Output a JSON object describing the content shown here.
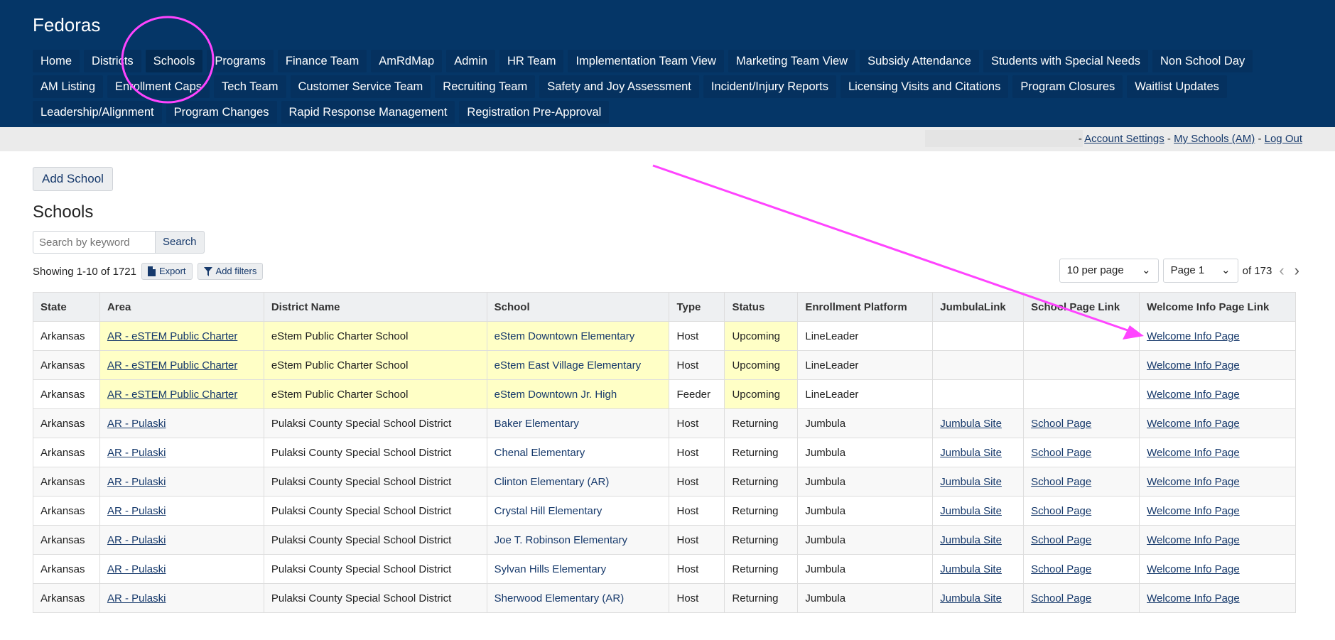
{
  "app": {
    "title": "Fedoras"
  },
  "nav": [
    "Home",
    "Districts",
    "Schools",
    "Programs",
    "Finance Team",
    "AmRdMap",
    "Admin",
    "HR Team",
    "Implementation Team View",
    "Marketing Team View",
    "Subsidy Attendance",
    "Students with Special Needs",
    "Non School Day",
    "AM Listing",
    "Enrollment Caps",
    "Tech Team",
    "Customer Service Team",
    "Recruiting Team",
    "Safety and Joy Assessment",
    "Incident/Injury Reports",
    "Licensing Visits and Citations",
    "Program Closures",
    "Waitlist Updates",
    "Leadership/Alignment",
    "Program Changes",
    "Rapid Response Management",
    "Registration Pre-Approval"
  ],
  "nav_active": "Schools",
  "userbar": {
    "sep": "-",
    "account_settings": "Account Settings",
    "my_schools": "My Schools (AM)",
    "log_out": "Log Out"
  },
  "main": {
    "add_button": "Add School",
    "title": "Schools",
    "search_placeholder": "Search by keyword",
    "search_button": "Search",
    "showing": "Showing 1-10 of 1721",
    "export": "Export",
    "add_filters": "Add filters",
    "per_page": "10 per page",
    "page": "Page 1",
    "of_pages": "of 173"
  },
  "colors": {
    "header": "#053667",
    "highlight": "#ffffc6",
    "annotation": "#ff44ff",
    "link": "#16396b"
  },
  "table": {
    "columns": [
      "State",
      "Area",
      "District Name",
      "School",
      "Type",
      "Status",
      "Enrollment Platform",
      "JumbulaLink",
      "School Page Link",
      "Welcome Info Page Link"
    ],
    "rows": [
      {
        "state": "Arkansas",
        "area": "AR - eSTEM Public Charter",
        "district": "eStem Public Charter School",
        "school": "eStem Downtown Elementary",
        "type": "Host",
        "status": "Upcoming",
        "platform": "LineLeader",
        "jumbula": "",
        "school_page": "",
        "welcome": "Welcome Info Page",
        "highlight": true
      },
      {
        "state": "Arkansas",
        "area": "AR - eSTEM Public Charter",
        "district": "eStem Public Charter School",
        "school": "eStem East Village Elementary",
        "type": "Host",
        "status": "Upcoming",
        "platform": "LineLeader",
        "jumbula": "",
        "school_page": "",
        "welcome": "Welcome Info Page",
        "highlight": true
      },
      {
        "state": "Arkansas",
        "area": "AR - eSTEM Public Charter",
        "district": "eStem Public Charter School",
        "school": "eStem Downtown Jr. High",
        "type": "Feeder",
        "status": "Upcoming",
        "platform": "LineLeader",
        "jumbula": "",
        "school_page": "",
        "welcome": "Welcome Info Page",
        "highlight": true
      },
      {
        "state": "Arkansas",
        "area": "AR - Pulaski",
        "district": "Pulaksi County Special School District",
        "school": "Baker Elementary",
        "type": "Host",
        "status": "Returning",
        "platform": "Jumbula",
        "jumbula": "Jumbula Site",
        "school_page": "School Page",
        "welcome": "Welcome Info Page",
        "highlight": false
      },
      {
        "state": "Arkansas",
        "area": "AR - Pulaski",
        "district": "Pulaksi County Special School District",
        "school": "Chenal Elementary",
        "type": "Host",
        "status": "Returning",
        "platform": "Jumbula",
        "jumbula": "Jumbula Site",
        "school_page": "School Page",
        "welcome": "Welcome Info Page",
        "highlight": false
      },
      {
        "state": "Arkansas",
        "area": "AR - Pulaski",
        "district": "Pulaksi County Special School District",
        "school": "Clinton Elementary (AR)",
        "type": "Host",
        "status": "Returning",
        "platform": "Jumbula",
        "jumbula": "Jumbula Site",
        "school_page": "School Page",
        "welcome": "Welcome Info Page",
        "highlight": false
      },
      {
        "state": "Arkansas",
        "area": "AR - Pulaski",
        "district": "Pulaksi County Special School District",
        "school": "Crystal Hill Elementary",
        "type": "Host",
        "status": "Returning",
        "platform": "Jumbula",
        "jumbula": "Jumbula Site",
        "school_page": "School Page",
        "welcome": "Welcome Info Page",
        "highlight": false
      },
      {
        "state": "Arkansas",
        "area": "AR - Pulaski",
        "district": "Pulaksi County Special School District",
        "school": "Joe T. Robinson Elementary",
        "type": "Host",
        "status": "Returning",
        "platform": "Jumbula",
        "jumbula": "Jumbula Site",
        "school_page": "School Page",
        "welcome": "Welcome Info Page",
        "highlight": false
      },
      {
        "state": "Arkansas",
        "area": "AR - Pulaski",
        "district": "Pulaksi County Special School District",
        "school": "Sylvan Hills Elementary",
        "type": "Host",
        "status": "Returning",
        "platform": "Jumbula",
        "jumbula": "Jumbula Site",
        "school_page": "School Page",
        "welcome": "Welcome Info Page",
        "highlight": false
      },
      {
        "state": "Arkansas",
        "area": "AR - Pulaski",
        "district": "Pulaksi County Special School District",
        "school": "Sherwood Elementary (AR)",
        "type": "Host",
        "status": "Returning",
        "platform": "Jumbula",
        "jumbula": "Jumbula Site",
        "school_page": "School Page",
        "welcome": "Welcome Info Page",
        "highlight": false
      }
    ]
  }
}
